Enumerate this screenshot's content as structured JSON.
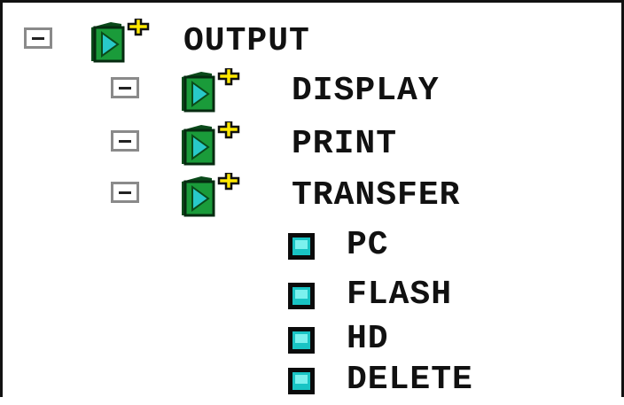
{
  "tree": {
    "root": {
      "label": "OUTPUT",
      "toggle_symbol": "minus",
      "icon": "folder-add-icon"
    },
    "folders": [
      {
        "label": "DISPLAY",
        "toggle_symbol": "minus",
        "icon": "folder-add-icon"
      },
      {
        "label": "PRINT",
        "toggle_symbol": "minus",
        "icon": "folder-add-icon"
      },
      {
        "label": "TRANSFER",
        "toggle_symbol": "minus",
        "icon": "folder-add-icon"
      }
    ],
    "leaves": [
      {
        "label": "PC",
        "icon": "leaf-node-icon"
      },
      {
        "label": "FLASH",
        "icon": "leaf-node-icon"
      },
      {
        "label": "HD",
        "icon": "leaf-node-icon"
      },
      {
        "label": "DELETE",
        "icon": "leaf-node-icon"
      }
    ]
  },
  "colors": {
    "folder_green": "#1a9b3a",
    "folder_dark": "#0a4a1a",
    "play_teal": "#28c9c9",
    "plus_yellow": "#ffe800",
    "leaf_teal": "#19c4c4",
    "toggle_border": "#8a8a8a"
  }
}
